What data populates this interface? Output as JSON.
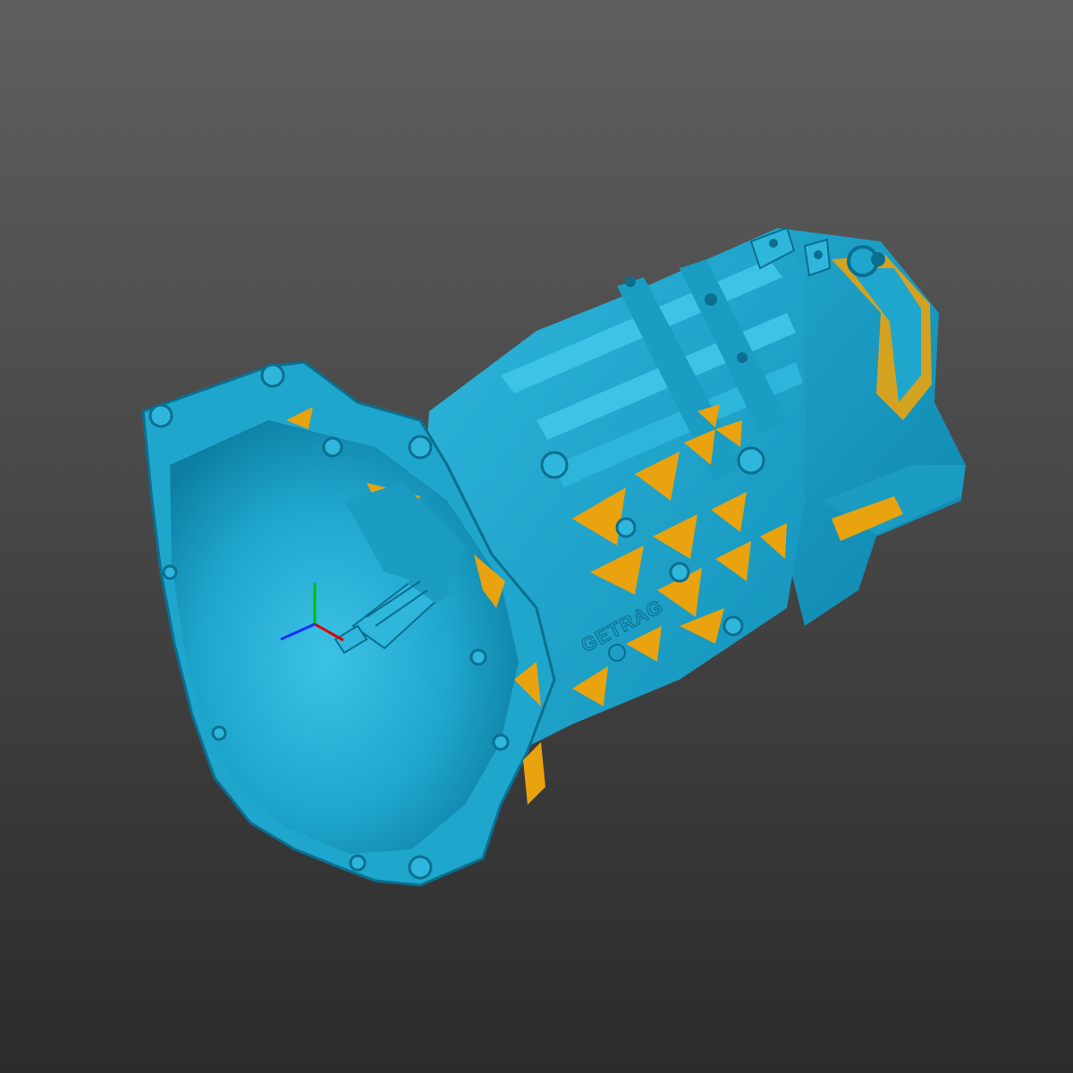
{
  "viewport": {
    "background_top": "#5f5f5f",
    "background_bottom": "#2b2b2b"
  },
  "model": {
    "description_icon": "gearbox-mesh",
    "surface_color": "#1ea5cc",
    "surface_highlight": "#3ec3e6",
    "surface_shadow": "#0c6f8f",
    "backface_color": "#e8a30e",
    "cast_text": "GETRAG"
  },
  "axes": {
    "x_color": "#e00000",
    "y_color": "#00c000",
    "z_color": "#1030ff"
  }
}
